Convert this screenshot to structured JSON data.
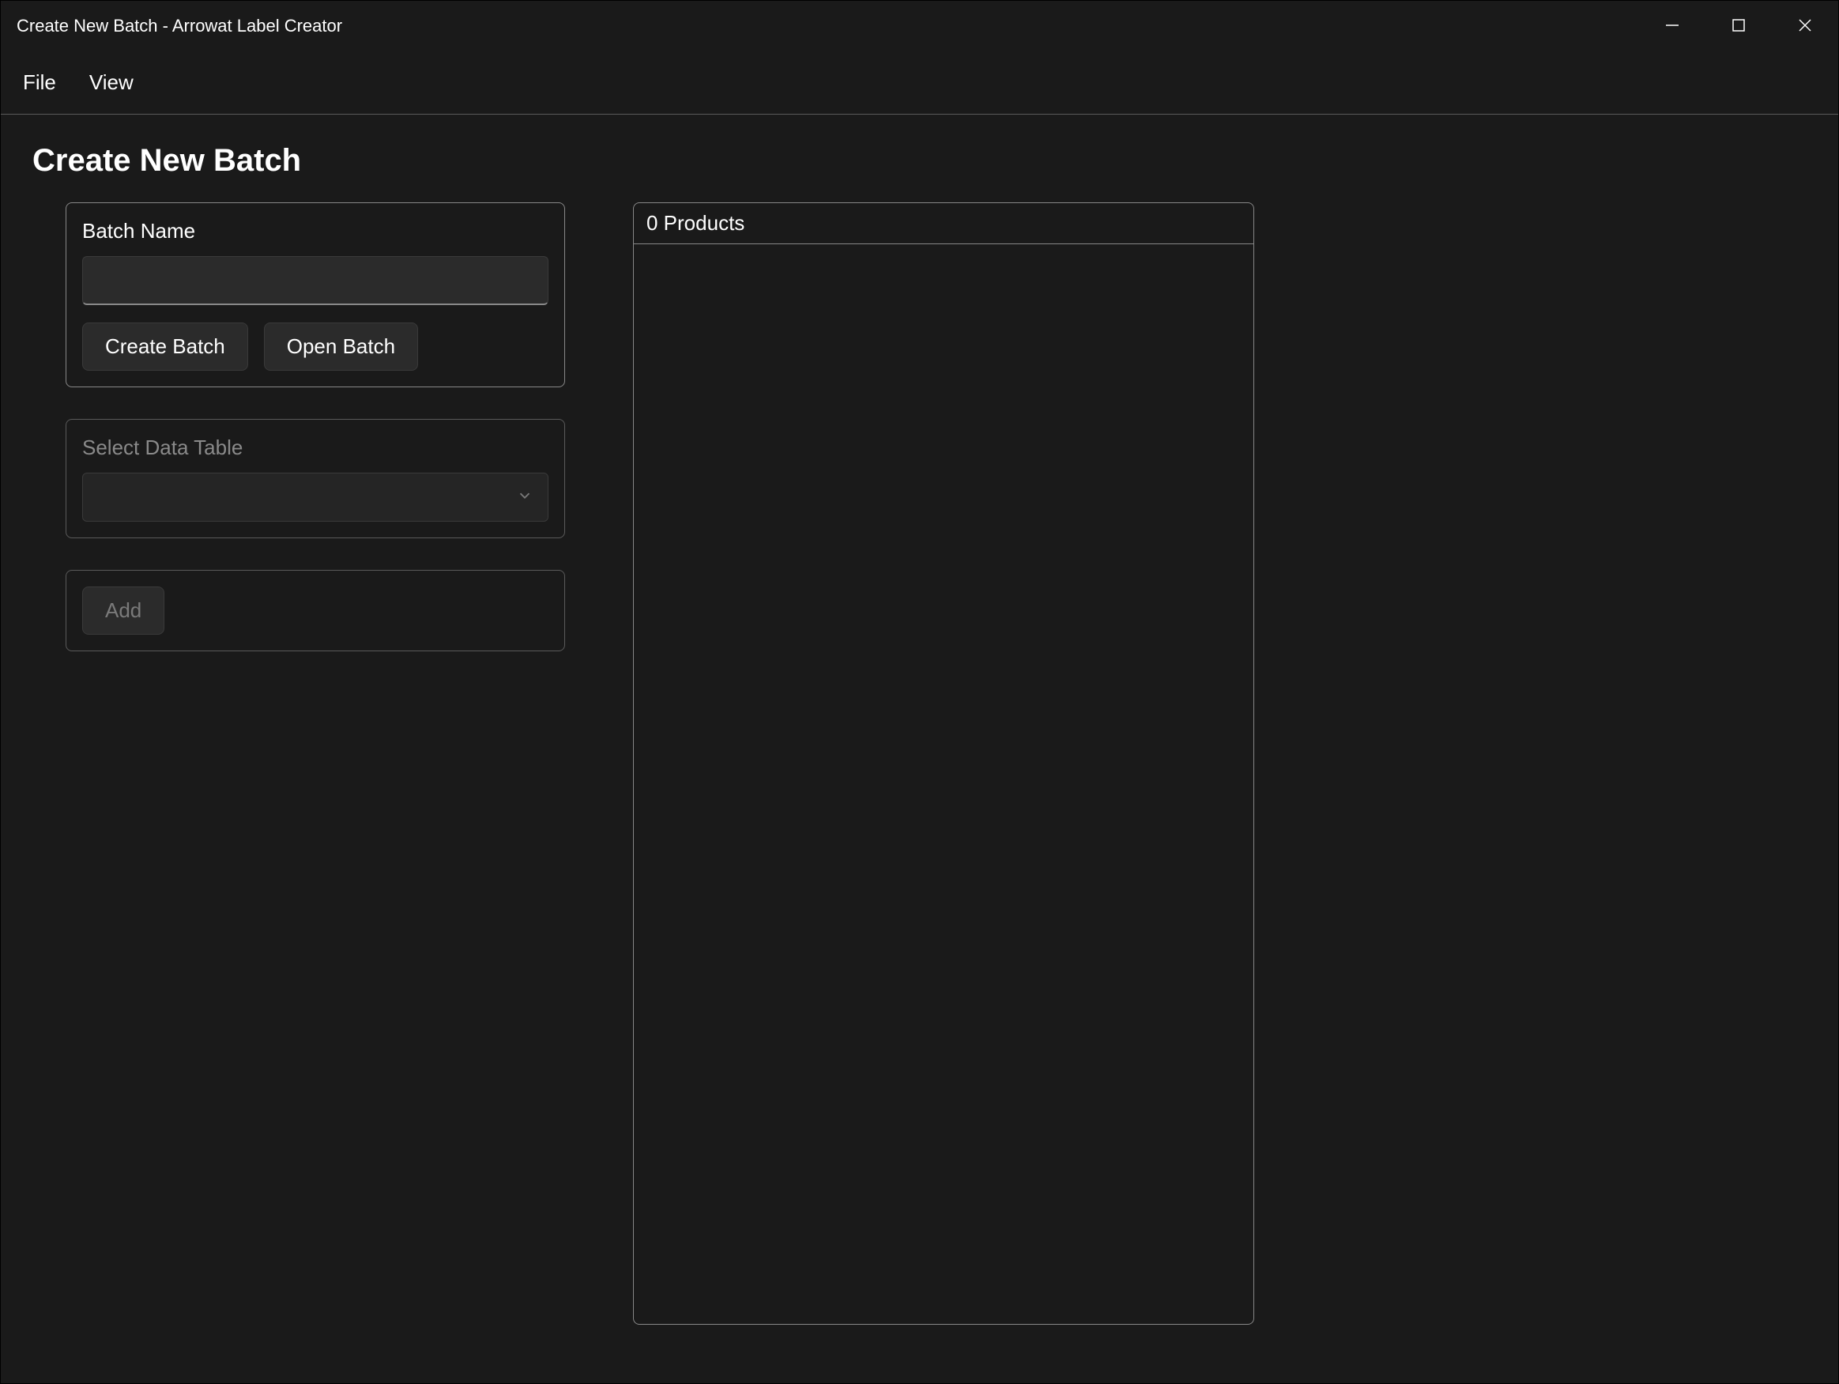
{
  "window": {
    "title": "Create New Batch - Arrowat Label Creator"
  },
  "menubar": {
    "file": "File",
    "view": "View"
  },
  "page": {
    "title": "Create New Batch"
  },
  "batch": {
    "label": "Batch Name",
    "value": "",
    "create_button": "Create Batch",
    "open_button": "Open Batch"
  },
  "data_table": {
    "label": "Select Data Table",
    "selected": ""
  },
  "add": {
    "button": "Add"
  },
  "products": {
    "count_label": "0 Products"
  }
}
